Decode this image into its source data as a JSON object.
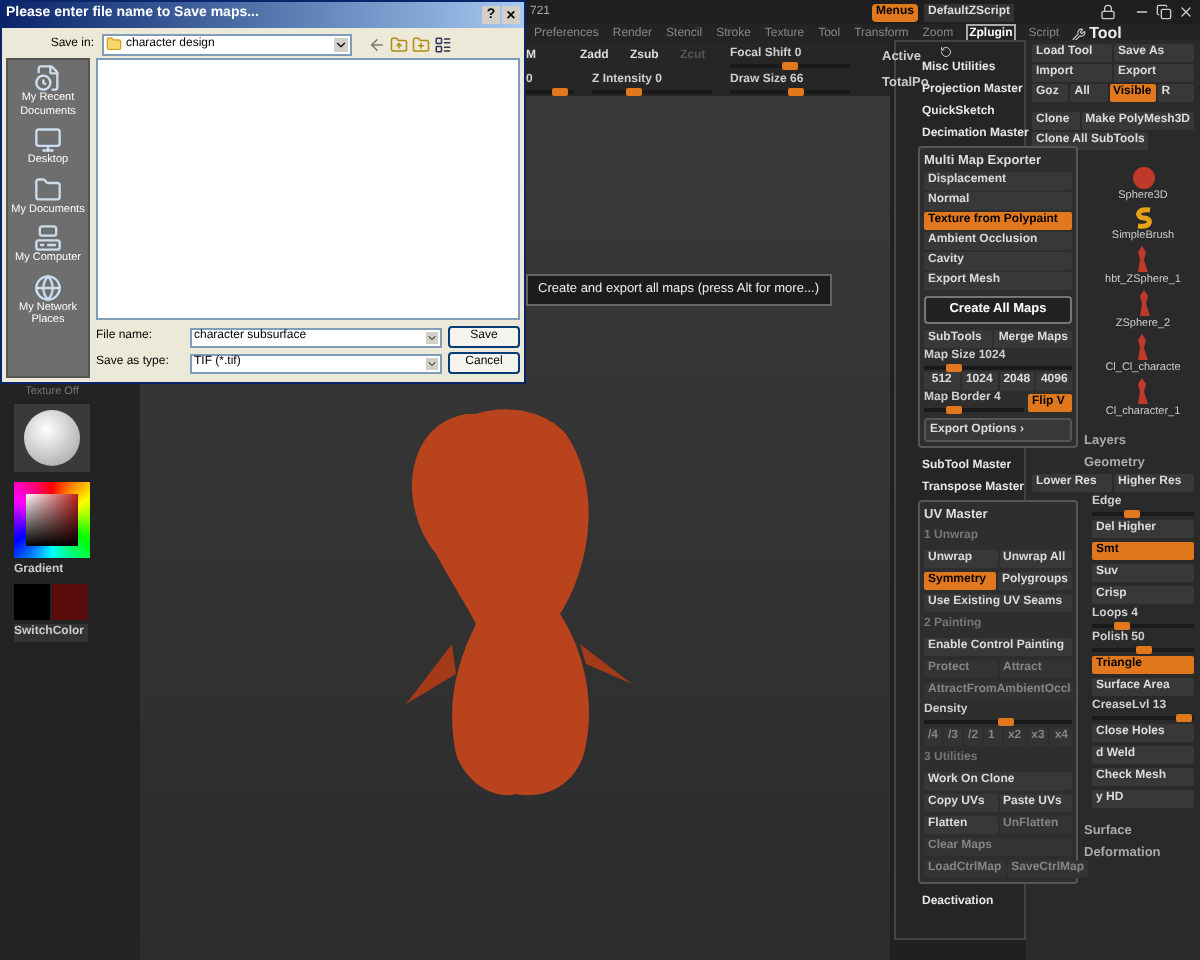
{
  "app": {
    "title": "721",
    "menus_button": "Menus",
    "script_button": "DefaultZScript"
  },
  "menu_bar": [
    {
      "label": "Preferences",
      "selected": false
    },
    {
      "label": "Render",
      "selected": false
    },
    {
      "label": "Stencil",
      "selected": false
    },
    {
      "label": "Stroke",
      "selected": false
    },
    {
      "label": "Texture",
      "selected": false
    },
    {
      "label": "Tool",
      "selected": false
    },
    {
      "label": "Transform",
      "selected": false
    },
    {
      "label": "Zoom",
      "selected": false
    },
    {
      "label": "Zplugin",
      "selected": true
    },
    {
      "label": "Script",
      "selected": false
    }
  ],
  "toolbar": {
    "buttons": [
      {
        "label": "M",
        "disabled": false
      },
      {
        "label": "Zadd",
        "disabled": false
      },
      {
        "label": "Zsub",
        "disabled": false
      },
      {
        "label": "Zcut",
        "disabled": true
      }
    ],
    "sliders": [
      {
        "label": "0",
        "level": 0.7
      },
      {
        "label": "Z Intensity 0",
        "level": 0.35
      },
      {
        "label": "Focal Shift 0",
        "level": 0.5
      },
      {
        "label": "Draw Size 66",
        "level": 0.55
      }
    ],
    "stats": [
      "Active",
      "TotalPo"
    ]
  },
  "left_shelf": {
    "texture_label": "Texture Off",
    "gradient_label": "Gradient",
    "switch_label": "SwitchColor"
  },
  "viewport": {
    "tooltip": "Create and export all maps (press Alt for more...)"
  },
  "zplugin_menu": {
    "items_top": [
      "Misc Utilities",
      "Projection Master",
      "QuickSketch",
      "Decimation Master"
    ],
    "multi_map_exporter": {
      "title": "Multi Map Exporter",
      "maps": [
        {
          "label": "Displacement",
          "on": false
        },
        {
          "label": "Normal",
          "on": false
        },
        {
          "label": "Texture from Polypaint",
          "on": true
        },
        {
          "label": "Ambient Occlusion",
          "on": false
        },
        {
          "label": "Cavity",
          "on": false
        },
        {
          "label": "Export Mesh",
          "on": false
        }
      ],
      "create_button": "Create All Maps",
      "options": [
        {
          "label": "SubTools",
          "on": false
        },
        {
          "label": "Merge Maps",
          "on": false
        }
      ],
      "map_size": {
        "label": "Map Size 1024",
        "level": 0.2
      },
      "sizes": [
        "512",
        "1024",
        "2048",
        "4096"
      ],
      "map_border": {
        "label": "Map Border 4",
        "level": 0.3
      },
      "flip": {
        "label": "Flip V",
        "on": true
      },
      "export_options": "Export Options ›"
    },
    "items_middle": [
      "SubTool Master",
      "Transpose Master"
    ],
    "uv_master": {
      "title": "UV Master",
      "rows": [
        {
          "kind": "section",
          "label": "1 Unwrap"
        },
        {
          "kind": "buttons",
          "items": [
            {
              "label": "Unwrap",
              "on": false,
              "disabled": false
            },
            {
              "label": "Unwrap All",
              "on": false,
              "disabled": false
            }
          ]
        },
        {
          "kind": "buttons",
          "items": [
            {
              "label": "Symmetry",
              "on": true,
              "disabled": false
            },
            {
              "label": "Polygroups",
              "on": false,
              "disabled": false
            }
          ]
        },
        {
          "kind": "buttons",
          "items": [
            {
              "label": "Use Existing UV Seams",
              "on": false,
              "disabled": false
            }
          ]
        },
        {
          "kind": "section",
          "label": "2 Painting"
        },
        {
          "kind": "buttons",
          "items": [
            {
              "label": "Enable Control Painting",
              "on": false,
              "disabled": false
            }
          ]
        },
        {
          "kind": "buttons",
          "items": [
            {
              "label": "Protect",
              "on": false,
              "disabled": true
            },
            {
              "label": "Attract",
              "on": false,
              "disabled": true
            }
          ]
        },
        {
          "kind": "buttons",
          "items": [
            {
              "label": "AttractFromAmbientOccl",
              "on": false,
              "disabled": true
            }
          ]
        },
        {
          "kind": "slider",
          "label": "Density",
          "level": 0.55
        },
        {
          "kind": "buttons",
          "items": [
            {
              "label": "/4",
              "on": false,
              "disabled": true
            },
            {
              "label": "/3",
              "on": false,
              "disabled": true
            },
            {
              "label": "/2",
              "on": false,
              "disabled": true
            },
            {
              "label": "1",
              "on": false,
              "disabled": true
            },
            {
              "label": "x2",
              "on": false,
              "disabled": true
            },
            {
              "label": "x3",
              "on": false,
              "disabled": true
            },
            {
              "label": "x4",
              "on": false,
              "disabled": true
            }
          ]
        },
        {
          "kind": "section",
          "label": "3 Utilities"
        },
        {
          "kind": "buttons",
          "items": [
            {
              "label": "Work On Clone",
              "on": false,
              "disabled": false
            }
          ]
        },
        {
          "kind": "buttons",
          "items": [
            {
              "label": "Copy UVs",
              "on": false,
              "disabled": false
            },
            {
              "label": "Paste UVs",
              "on": false,
              "disabled": false
            }
          ]
        },
        {
          "kind": "buttons",
          "items": [
            {
              "label": "Flatten",
              "on": false,
              "disabled": false
            },
            {
              "label": "UnFlatten",
              "on": false,
              "disabled": true
            }
          ]
        },
        {
          "kind": "buttons",
          "items": [
            {
              "label": "Clear Maps",
              "on": false,
              "disabled": true
            }
          ]
        },
        {
          "kind": "buttons",
          "items": [
            {
              "label": "LoadCtrlMap",
              "on": false,
              "disabled": true
            },
            {
              "label": "SaveCtrlMap",
              "on": false,
              "disabled": true
            }
          ]
        }
      ]
    },
    "items_bottom": [
      "Deactivation"
    ]
  },
  "tool_panel": {
    "title": "Tool",
    "button_rows": [
      [
        {
          "label": "Load Tool",
          "on": false
        },
        {
          "label": "Save As",
          "on": false
        }
      ],
      [
        {
          "label": "Import",
          "on": false
        },
        {
          "label": "Export",
          "on": false
        }
      ],
      [
        {
          "label": "Goz",
          "on": false
        },
        {
          "label": "All",
          "on": false
        },
        {
          "label": "Visible",
          "on": true
        },
        {
          "label": "R",
          "on": false
        }
      ],
      [
        {
          "label": "Clone",
          "on": false
        },
        {
          "label": "Make PolyMesh3D",
          "on": false
        }
      ],
      [
        {
          "label": "Clone All SubTools",
          "on": false
        }
      ]
    ],
    "tools": [
      {
        "label": "Sphere3D",
        "kind": "sphere"
      },
      {
        "label": "SimpleBrush",
        "kind": "brush"
      },
      {
        "label": "hbt_ZSphere_1",
        "kind": "figure"
      },
      {
        "label": "ZSphere_2",
        "kind": "figure"
      },
      {
        "label": "Cl_Cl_characte",
        "kind": "figure"
      },
      {
        "label": "Cl_character_1",
        "kind": "figure"
      }
    ],
    "sections": [
      "Layers",
      "Geometry"
    ],
    "geometry": [
      {
        "kind": "pair",
        "items": [
          {
            "label": "Lower Res",
            "on": false
          },
          {
            "label": "Higher Res",
            "on": false
          }
        ]
      },
      {
        "kind": "slider",
        "label": "Edge",
        "level": 0.4
      },
      {
        "kind": "pair",
        "items": [
          {
            "label": "Del Higher",
            "on": false
          }
        ]
      },
      {
        "kind": "pair",
        "items": [
          {
            "label": "Smt",
            "on": true
          }
        ]
      },
      {
        "kind": "pair",
        "items": [
          {
            "label": "Suv",
            "on": false
          }
        ]
      },
      {
        "kind": "pair",
        "items": [
          {
            "label": "Crisp",
            "on": false
          }
        ]
      },
      {
        "kind": "slider",
        "label": "Loops 4",
        "level": 0.3
      },
      {
        "kind": "slider",
        "label": "Polish 50",
        "level": 0.5
      },
      {
        "kind": "pair",
        "items": [
          {
            "label": "Triangle",
            "on": true
          }
        ]
      },
      {
        "kind": "pair",
        "items": [
          {
            "label": "Surface Area",
            "on": false
          }
        ]
      },
      {
        "kind": "slider",
        "label": "CreaseLvl 13",
        "level": 0.9
      },
      {
        "kind": "pair",
        "items": [
          {
            "label": "Close Holes",
            "on": false
          }
        ]
      },
      {
        "kind": "pair",
        "items": [
          {
            "label": "d Weld",
            "on": false
          }
        ]
      },
      {
        "kind": "pair",
        "items": [
          {
            "label": "Check Mesh",
            "on": false
          }
        ]
      },
      {
        "kind": "pair",
        "items": [
          {
            "label": "y HD",
            "on": false
          }
        ]
      }
    ],
    "subsections": [
      "Surface",
      "Deformation"
    ]
  },
  "save_dialog": {
    "title": "Please enter file name to Save maps...",
    "help_button": "?",
    "close_button": "×",
    "save_in_label": "Save in:",
    "folder": "character design",
    "places": [
      {
        "label": "My Recent Documents",
        "kind": "recent"
      },
      {
        "label": "Desktop",
        "kind": "desktop"
      },
      {
        "label": "My Documents",
        "kind": "documents"
      },
      {
        "label": "My Computer",
        "kind": "computer"
      },
      {
        "label": "My Network Places",
        "kind": "network"
      }
    ],
    "file_name_label": "File name:",
    "file_name": "character subsurface",
    "type_label": "Save as type:",
    "file_type": "TIF (*.tif)",
    "save_button": "Save",
    "cancel_button": "Cancel"
  }
}
